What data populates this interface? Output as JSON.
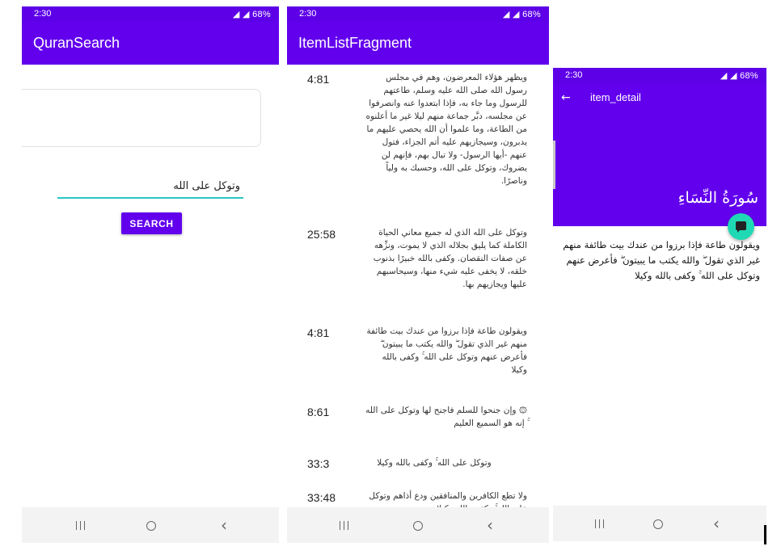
{
  "colors": {
    "primary": "#6200ee",
    "status": "#5d00e8",
    "accent": "#26c6c6",
    "fab": "#1fd9b5"
  },
  "phone1": {
    "status": {
      "time": "2:30",
      "indicators": "68%"
    },
    "app_title": "QuranSearch",
    "search": {
      "value": "وتوكل على الله",
      "button": "SEARCH"
    }
  },
  "phone2": {
    "status": {
      "time": "2:30",
      "indicators": "68%"
    },
    "app_title": "ItemListFragment",
    "items": [
      {
        "ref": "4:81",
        "text": "ويظهر هؤلاء المعرضون، وهم في مجلس رسول الله صلى الله عليه وسلم، طاعتهم للرسول وما جاء به، فإذا ابتعدوا عنه وانصرفوا عن مجلسه، دبَّر جماعة منهم ليلا غير ما أعلنوه من الطاعة، وما علموا أن الله يحصي عليهم ما يدبرون، وسيجازيهم عليه أتم الجزاء، فتول عنهم -أيها الرسول- ولا تبال بهم، فإنهم لن يضروك، وتوكل على الله، وحسبك به ولياً وناصرًا."
      },
      {
        "ref": "25:58",
        "text": "وتوكل على الله الذي له جميع معاني الحياة الكاملة كما يليق بجلاله الذي لا يموت، ونزِّهه عن صفات النقصان. وكفى بالله خبيرًا بذنوب خلقه، لا يخفى عليه شيء منها، وسيحاسبهم عليها ويجازيهم بها."
      },
      {
        "ref": "4:81",
        "text": "ويقولون طاعة فإذا برزوا من عندك بيت طائفة منهم غير الذي تقول ۖ والله يكتب ما يبيتون ۖ فأعرض عنهم وتوكل على الله ۚ وكفى بالله وكيلا"
      },
      {
        "ref": "8:61",
        "text": "۞ وإن جنحوا للسلم فاجنح لها وتوكل على الله ۚ إنه هو السميع العليم"
      },
      {
        "ref": "33:3",
        "text": "وتوكل على الله ۚ وكفى بالله وكيلا"
      },
      {
        "ref": "33:48",
        "text": "ولا تطع الكافرين والمنافقين ودع أذاهم وتوكل على الله ۚ وكفى بالله وكيلا"
      }
    ]
  },
  "phone3": {
    "status": {
      "time": "2:30",
      "indicators": "68%"
    },
    "app_title": "item_detail",
    "surah": "سُورَةُ النِّسَاءِ",
    "detail": "ويقولون طاعة فإذا برزوا من عندك بيت طائفة منهم غير الذي تقول ۖ والله يكتب ما يبيتون ۖ فأعرض عنهم وتوكل على الله ۚ وكفى بالله وكيلا",
    "icons": {
      "back": "arrow-back-icon",
      "fab": "message-icon"
    }
  }
}
